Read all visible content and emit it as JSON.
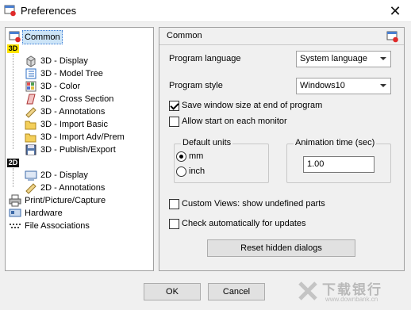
{
  "window": {
    "title": "Preferences"
  },
  "tree": {
    "root_common": "Common",
    "badge_3d": "3D",
    "badge_2d": "2D",
    "items_3d": [
      {
        "label": "3D - Display",
        "icon": "cube-icon"
      },
      {
        "label": "3D - Model Tree",
        "icon": "model-tree-icon"
      },
      {
        "label": "3D - Color",
        "icon": "color-grid-icon"
      },
      {
        "label": "3D - Cross Section",
        "icon": "cross-section-icon"
      },
      {
        "label": "3D - Annotations",
        "icon": "ruler-icon"
      },
      {
        "label": "3D - Import Basic",
        "icon": "folder-open-icon"
      },
      {
        "label": "3D - Import Adv/Prem",
        "icon": "folder-open-icon"
      },
      {
        "label": "3D - Publish/Export",
        "icon": "floppy-disk-icon"
      }
    ],
    "items_2d": [
      {
        "label": "2D - Display",
        "icon": "monitor-icon"
      },
      {
        "label": "2D - Annotations",
        "icon": "ruler-icon"
      }
    ],
    "print": "Print/Picture/Capture",
    "hardware": "Hardware",
    "file_assoc": "File Associations"
  },
  "panel": {
    "title": "Common",
    "program_language_label": "Program language",
    "program_language_value": "System language",
    "program_style_label": "Program style",
    "program_style_value": "Windows10",
    "save_window_label": "Save window size at end of program",
    "save_window_checked": true,
    "allow_start_label": "Allow start on each monitor",
    "allow_start_checked": false,
    "default_units_title": "Default units",
    "unit_mm": "mm",
    "unit_inch": "inch",
    "unit_selected": "mm",
    "animation_title": "Animation time (sec)",
    "animation_value": "1.00",
    "custom_views_label": "Custom Views: show undefined parts",
    "custom_views_checked": false,
    "check_updates_label": "Check automatically for updates",
    "check_updates_checked": false,
    "reset_button": "Reset hidden dialogs"
  },
  "footer": {
    "ok": "OK",
    "cancel": "Cancel"
  },
  "watermark": {
    "brand": "下载银行",
    "url": "www.downbank.cn"
  },
  "colors": {
    "selection": "#cce4f7",
    "badge_3d": "#ffe400",
    "badge_2d": "#111111"
  }
}
